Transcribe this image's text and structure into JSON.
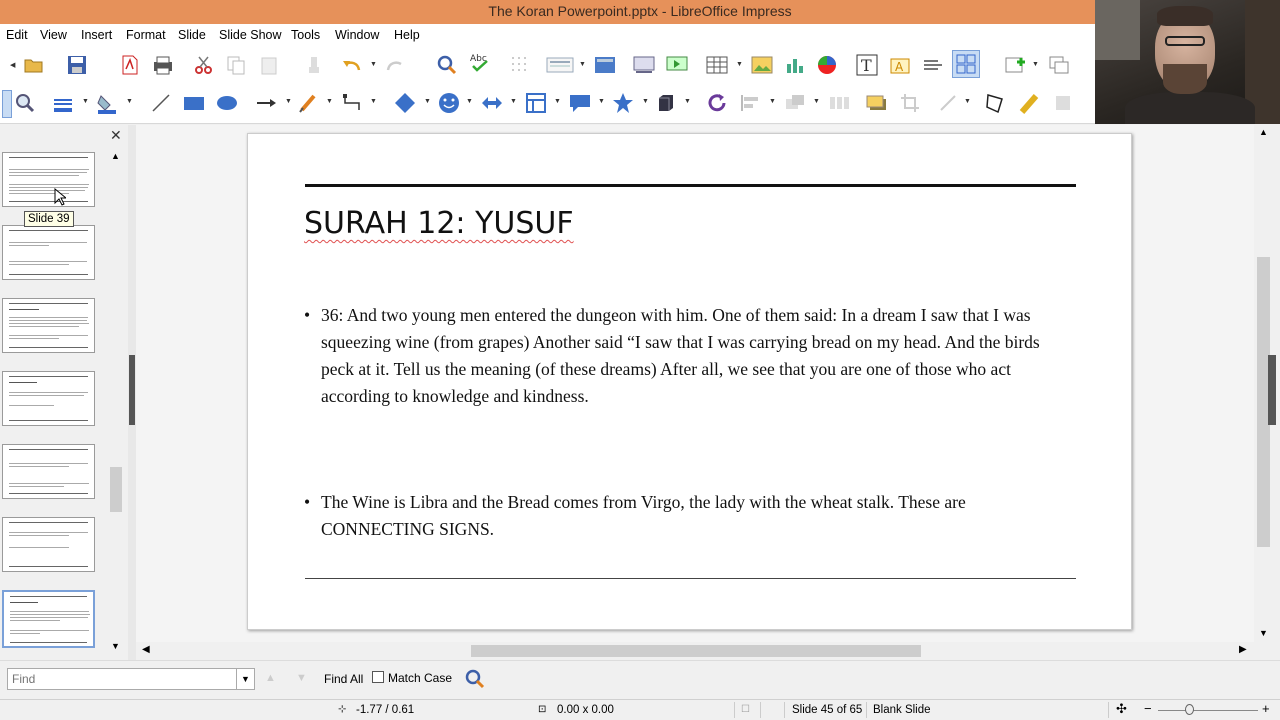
{
  "window": {
    "title": "The Koran Powerpoint.pptx - LibreOffice Impress"
  },
  "menu": [
    "Edit",
    "View",
    "Insert",
    "Format",
    "Slide",
    "Slide Show",
    "Tools",
    "Window",
    "Help"
  ],
  "slide_panel": {
    "tooltip": "Slide 39"
  },
  "slide": {
    "title": "SURAH 12: YUSUF",
    "bullets": [
      "36: And two young men entered the dungeon with him. One of them said: In a dream I saw that I was squeezing wine (from grapes) Another said “I saw that I was carrying bread on my head. And the birds peck at it. Tell us the meaning (of these dreams) After all, we see that you are one of those who act according to knowledge and kindness.",
      "The Wine is Libra and the Bread comes from Virgo, the lady with the wheat stalk. These are CONNECTING SIGNS."
    ]
  },
  "findbar": {
    "placeholder": "Find",
    "find_all": "Find All",
    "match_case": "Match Case"
  },
  "status": {
    "position": "-1.77 / 0.61",
    "size": "0.00 x 0.00",
    "slide_info": "Slide 45 of 65",
    "layout": "Blank Slide"
  },
  "colors": {
    "titlebar": "#e6915a",
    "selection": "#7aa0d8"
  }
}
